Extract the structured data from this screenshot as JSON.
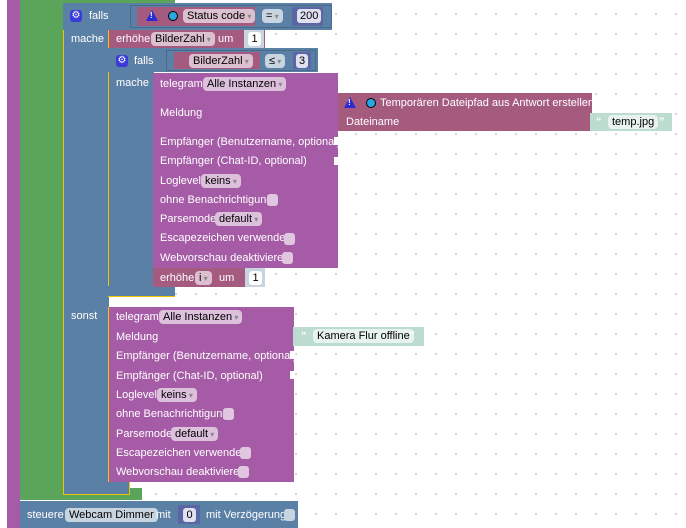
{
  "outer_if": {
    "falls": "falls",
    "mache": "mache",
    "sonst": "sonst",
    "condition": {
      "left": "Status code",
      "operator": "=",
      "right": "200"
    }
  },
  "increment_1": {
    "label": "erhöhe",
    "variable": "BilderZahl",
    "by_label": "um",
    "value": "1"
  },
  "inner_if": {
    "falls": "falls",
    "mache": "mache",
    "condition": {
      "left": "BilderZahl",
      "operator": "≤",
      "right": "3"
    }
  },
  "telegram_1": {
    "label": "telegram",
    "instance": "Alle Instanzen",
    "message_label": "Meldung",
    "recipient_user": "Empfänger (Benutzername, optional)",
    "recipient_chat": "Empfänger (Chat-ID, optional)",
    "loglevel_label": "Loglevel",
    "loglevel": "keins",
    "silent_label": "ohne Benachrichtigung",
    "parsemode_label": "Parsemode",
    "parsemode": "default",
    "escape_label": "Escapezeichen verwenden",
    "preview_label": "Webvorschau deaktivieren"
  },
  "temp_path": {
    "title": "Temporären Dateipfad aus Antwort erstellen",
    "filename_label": "Dateiname",
    "filename": "temp.jpg"
  },
  "increment_2": {
    "label": "erhöhe",
    "variable": "i",
    "by_label": "um",
    "value": "1"
  },
  "telegram_2": {
    "label": "telegram",
    "instance": "Alle Instanzen",
    "message_label": "Meldung",
    "message": "Kamera Flur offline",
    "recipient_user": "Empfänger (Benutzername, optional)",
    "recipient_chat": "Empfänger (Chat-ID, optional)",
    "loglevel_label": "Loglevel",
    "loglevel": "keins",
    "silent_label": "ohne Benachrichtigung",
    "parsemode_label": "Parsemode",
    "parsemode": "default",
    "escape_label": "Escapezeichen verwenden",
    "preview_label": "Webvorschau deaktivieren"
  },
  "control": {
    "label": "steuere",
    "object": "Webcam  Dimmer",
    "with_label": "mit",
    "value": "0",
    "delay_label": "mit Verzögerung"
  },
  "colors": {
    "logic": "#5b80a5",
    "variable": "#a55b80",
    "telegram": "#a55ba5",
    "loop": "#5ba55b",
    "text": "#bcdcd0"
  }
}
